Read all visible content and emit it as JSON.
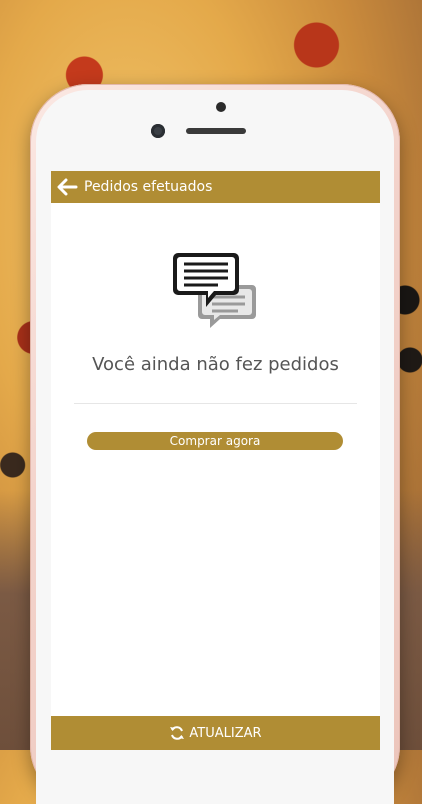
{
  "header": {
    "title": "Pedidos efetuados"
  },
  "empty_state": {
    "message": "Você ainda não fez pedidos",
    "icon": "chat-bubbles-icon"
  },
  "actions": {
    "buy_label": "Comprar agora",
    "refresh_label": "ATUALIZAR"
  },
  "colors": {
    "accent": "#b08d34",
    "text": "#555555"
  }
}
